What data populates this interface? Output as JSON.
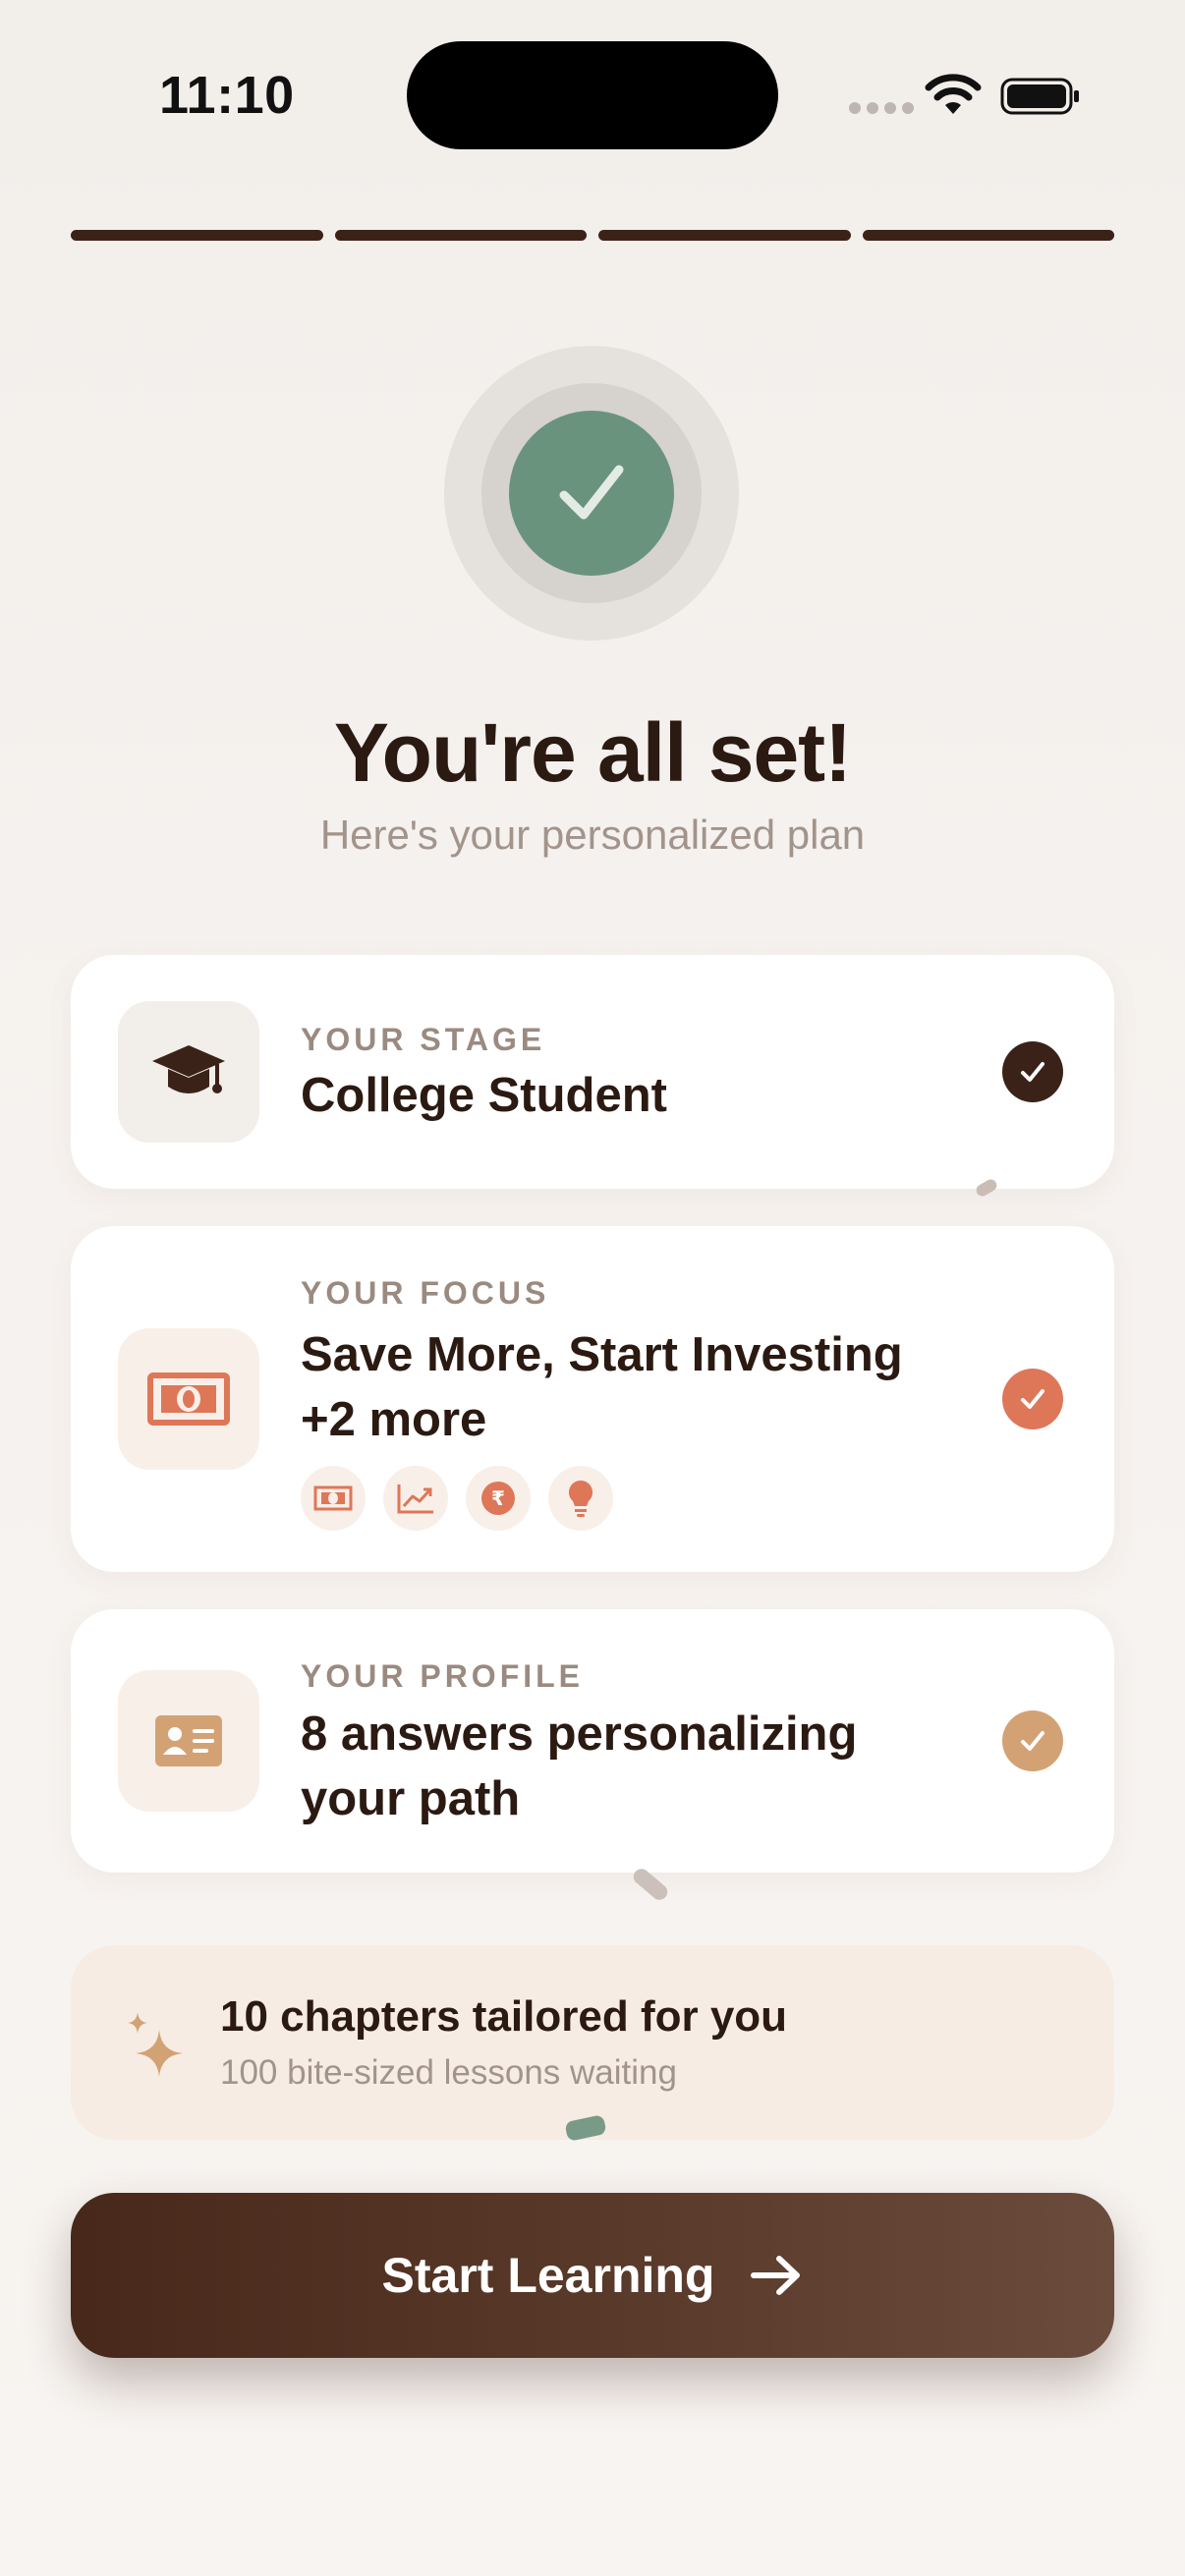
{
  "status_bar": {
    "time": "11:10"
  },
  "progress": {
    "steps_total": 4,
    "steps_completed": 4
  },
  "header": {
    "title": "You're all set!",
    "subtitle": "Here's your personalized plan"
  },
  "cards": [
    {
      "label": "YOUR STAGE",
      "value": "College Student",
      "icon": "graduation-cap-icon",
      "check_color": "#3b2219"
    },
    {
      "label": "YOUR FOCUS",
      "value": "Save More, Start Investing +2 more",
      "icon": "banknote-icon",
      "check_color": "#de7758",
      "chip_icons": [
        "banknote-icon",
        "trending-up-icon",
        "rupee-icon",
        "lightbulb-icon"
      ]
    },
    {
      "label": "YOUR PROFILE",
      "value": "8 answers personalizing your path",
      "icon": "id-card-icon",
      "check_color": "#d3a274"
    }
  ],
  "banner": {
    "title": "10 chapters tailored for you",
    "subtitle": "100 bite-sized lessons waiting",
    "icon": "sparkle-icon"
  },
  "cta": {
    "label": "Start Learning",
    "icon": "arrow-right-icon"
  },
  "colors": {
    "accent_dark": "#3b2219",
    "success_green": "#6a937d",
    "focus_orange": "#de7758",
    "profile_tan": "#d3a274"
  }
}
